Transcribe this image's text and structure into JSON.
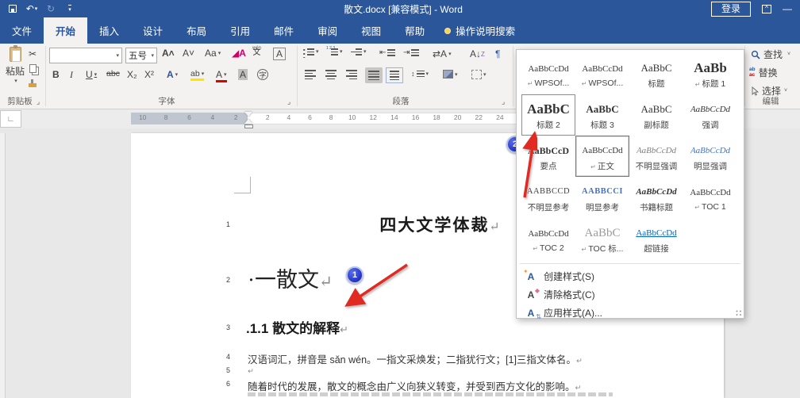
{
  "titlebar": {
    "title": "散文.docx [兼容模式]  -  Word",
    "signin_label": "登录"
  },
  "tabs": {
    "file": "文件",
    "items": [
      {
        "label": "开始",
        "state": "active"
      },
      {
        "label": "插入"
      },
      {
        "label": "设计"
      },
      {
        "label": "布局"
      },
      {
        "label": "引用"
      },
      {
        "label": "邮件"
      },
      {
        "label": "审阅"
      },
      {
        "label": "视图"
      },
      {
        "label": "帮助"
      }
    ],
    "tellme": "操作说明搜索"
  },
  "ribbon": {
    "clipboard": {
      "paste_label": "粘贴",
      "group_label": "剪贴板"
    },
    "font": {
      "font_name": "",
      "font_size": "五号",
      "group_label": "字体"
    },
    "paragraph": {
      "group_label": "段落"
    },
    "editing": {
      "find_label": "查找",
      "replace_label": "替换",
      "select_label": "选择",
      "group_label": "编辑"
    }
  },
  "ruler": {
    "left_numbers": [
      "10",
      "8",
      "6",
      "4",
      "2"
    ],
    "right_numbers": [
      "2",
      "4",
      "6",
      "8",
      "10",
      "12",
      "14",
      "16",
      "18",
      "20",
      "22",
      "24"
    ]
  },
  "document": {
    "line_numbers": [
      "1",
      "2",
      "3",
      "4",
      "5",
      "6"
    ],
    "title": "四大文学体裁",
    "heading1": "·一散文",
    "heading2": ".1.1 散文的解释",
    "para1": "汉语词汇，拼音是 sǎn wén。一指文采焕发；二指犹行文；[1]三指文体名。",
    "para2": "随着时代的发展，散文的概念由广义向狭义转变，并受到西方文化的影响。",
    "mark": "↵"
  },
  "styles_panel": {
    "gallery": [
      {
        "preview": "AaBbCcDd",
        "label": "WPSOf...",
        "pilcrow": true,
        "variant": "small"
      },
      {
        "preview": "AaBbCcDd",
        "label": "WPSOf...",
        "pilcrow": true,
        "variant": "small"
      },
      {
        "preview": "AaBbC",
        "label": "标题",
        "variant": "medium"
      },
      {
        "preview": "AaBb",
        "label": "标题 1",
        "pilcrow": true,
        "variant": "large-bold"
      },
      {
        "preview": "AaBbC",
        "label": "标题 2",
        "variant": "large-bold",
        "state": "hover"
      },
      {
        "preview": "AaBbC",
        "label": "标题 3",
        "variant": "medium-bold"
      },
      {
        "preview": "AaBbC",
        "label": "副标题",
        "variant": "medium"
      },
      {
        "preview": "AaBbCcDd",
        "label": "强调",
        "variant": "italic"
      },
      {
        "preview": "AaBbCcD",
        "label": "要点",
        "variant": "bold"
      },
      {
        "preview": "AaBbCcDd",
        "label": "正文",
        "pilcrow": true,
        "variant": "small",
        "state": "selected"
      },
      {
        "preview": "AaBbCcDd",
        "label": "不明显强调",
        "variant": "italic-gray"
      },
      {
        "preview": "AaBbCcDd",
        "label": "明显强调",
        "variant": "italic-blue"
      },
      {
        "preview": "AABBCCD",
        "label": "不明显参考",
        "variant": "smallcaps"
      },
      {
        "preview": "AABBCCI",
        "label": "明显参考",
        "variant": "smallcaps-blue"
      },
      {
        "preview": "AaBbCcDd",
        "label": "书籍标题",
        "variant": "bold-italic"
      },
      {
        "preview": "AaBbCcDd",
        "label": "TOC 1",
        "pilcrow": true,
        "variant": "small"
      },
      {
        "preview": "AaBbCcDd",
        "label": "TOC 2",
        "pilcrow": true,
        "variant": "small"
      },
      {
        "preview": "AaBbC",
        "label": "TOC 标...",
        "pilcrow": true,
        "variant": "large-gray"
      },
      {
        "preview": "AaBbCcDd",
        "label": "超链接",
        "variant": "link"
      }
    ],
    "pilcrow_glyph": "↵",
    "menu": [
      {
        "label": "创建样式(S)",
        "icon": "create-style-icon"
      },
      {
        "label": "清除格式(C)",
        "icon": "clear-format-icon"
      },
      {
        "label": "应用样式(A)...",
        "icon": "apply-styles-icon"
      }
    ]
  },
  "annotations": {
    "callout1": "1",
    "callout2": "2"
  },
  "colors": {
    "titlebar": "#2b579a",
    "arrow": "#e02b20",
    "callout": "#2638d4",
    "hyperlink": "#0563c1"
  }
}
